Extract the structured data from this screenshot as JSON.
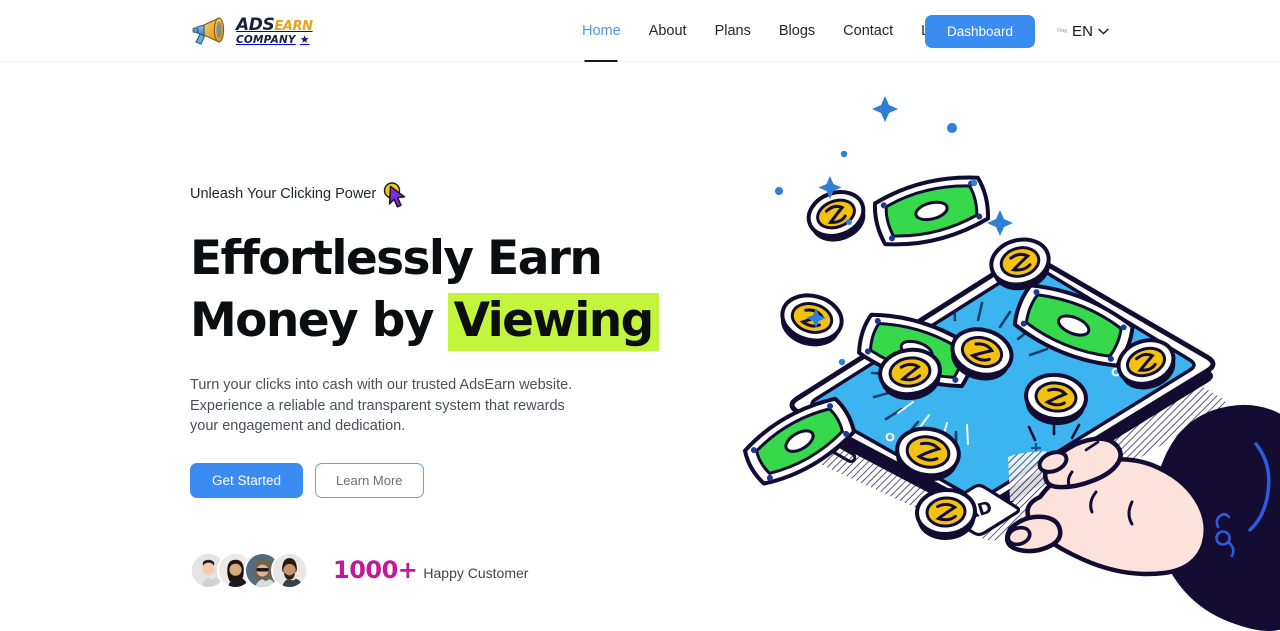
{
  "header": {
    "logo": {
      "icon": "megaphone-icon",
      "text_ads": "ADS",
      "text_earn": "EARN",
      "text_company": "COMPANY",
      "star": "★"
    },
    "nav": [
      {
        "label": "Home",
        "active": true
      },
      {
        "label": "About",
        "active": false
      },
      {
        "label": "Plans",
        "active": false
      },
      {
        "label": "Blogs",
        "active": false
      },
      {
        "label": "Contact",
        "active": false
      },
      {
        "label": "Logout",
        "active": false
      }
    ],
    "dashboard_button": "Dashboard",
    "language": {
      "flag_label": "Flag",
      "code": "EN",
      "chevron": "chevron-down-icon"
    }
  },
  "hero": {
    "eyebrow": "Unleash Your Clicking Power",
    "cursor_icon": "mouse-cursor-icon",
    "title_line1": "Effortlessly Earn",
    "title_line2_prefix": "Money by",
    "title_highlight": "Viewing",
    "description": "Turn your clicks into cash with our trusted AdsEarn website. Experience a reliable and transparent system that rewards your engagement and dedication.",
    "primary_cta": "Get Started",
    "secondary_cta": "Learn More",
    "social_proof": {
      "avatar_count": 4,
      "count": "1000+",
      "label": "Happy Customer"
    },
    "illustration": {
      "name": "hand-tapping-phone-ad-illustration",
      "ad_button_label": "AD",
      "phone_screen_color": "#3bb4ef",
      "money_color": "#35d94b",
      "coin_color": "#f2c20c"
    }
  },
  "colors": {
    "accent_blue": "#3b8cf0",
    "nav_active": "#4a9ae8",
    "highlight_green": "#c2f53c",
    "magenta": "#c2189c",
    "ink": "#0c0d10",
    "logo_orange": "#e8a317",
    "logo_navy": "#17213f"
  }
}
